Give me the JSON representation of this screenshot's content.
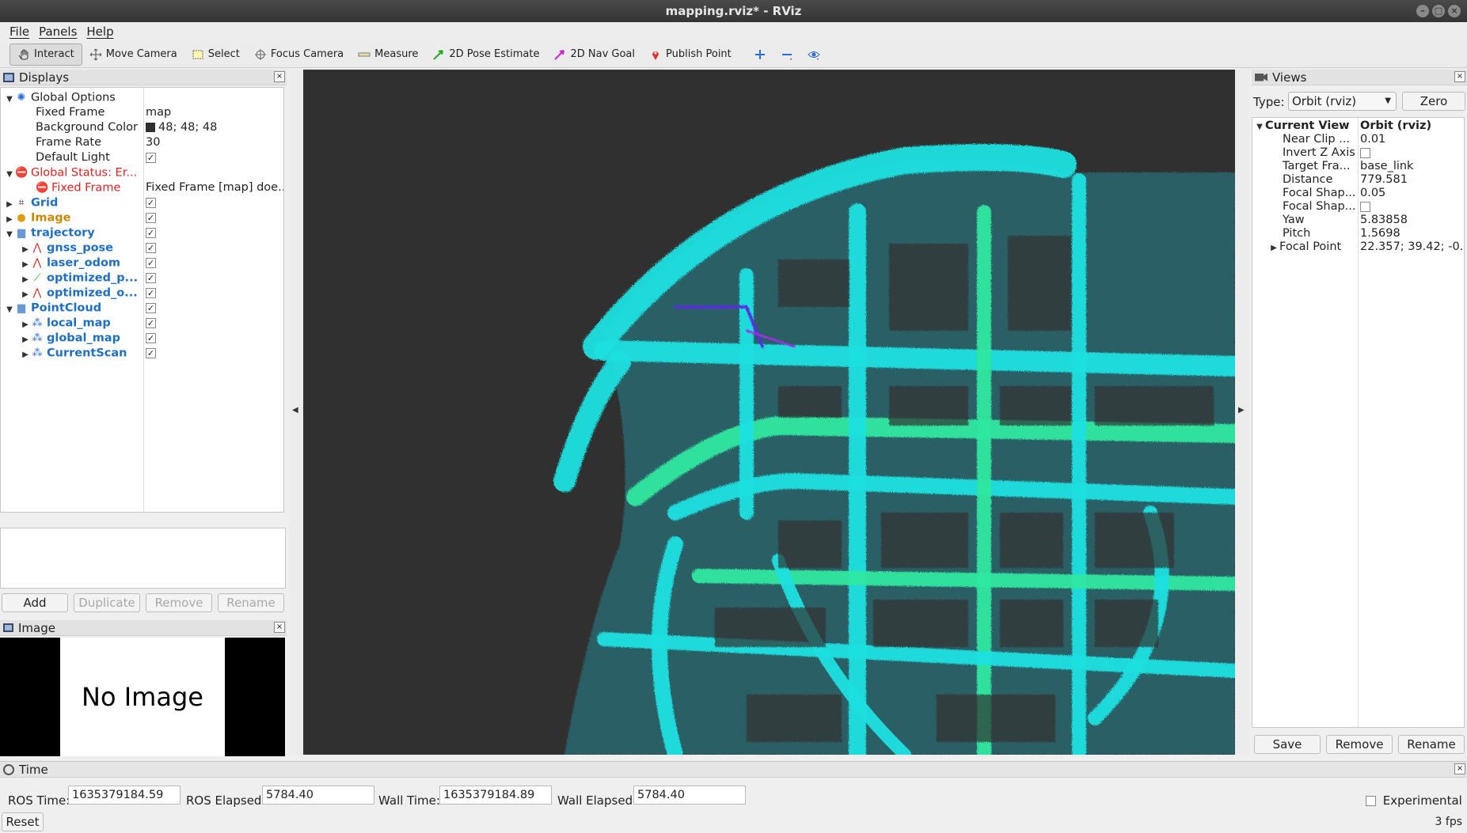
{
  "window": {
    "title": "mapping.rviz* - RViz"
  },
  "menubar": {
    "file": "File",
    "panels": "Panels",
    "help": "Help"
  },
  "toolbar": {
    "interact": "Interact",
    "move_camera": "Move Camera",
    "select": "Select",
    "focus_camera": "Focus Camera",
    "measure": "Measure",
    "pose_estimate": "2D Pose Estimate",
    "nav_goal": "2D Nav Goal",
    "publish_point": "Publish Point"
  },
  "displays": {
    "title": "Displays",
    "rows": {
      "global_options": "Global Options",
      "fixed_frame_label": "Fixed Frame",
      "fixed_frame_value": "map",
      "bg_color_label": "Background Color",
      "bg_color_value": "48; 48; 48",
      "frame_rate_label": "Frame Rate",
      "frame_rate_value": "30",
      "default_light_label": "Default Light",
      "global_status": "Global Status: Er...",
      "fixed_frame_err": "Fixed Frame",
      "fixed_frame_err_value": "Fixed Frame [map] doe...",
      "grid": "Grid",
      "image": "Image",
      "trajectory": "trajectory",
      "gnss_pose": "gnss_pose",
      "laser_odom": "laser_odom",
      "optimized_p": "optimized_p...",
      "optimized_o": "optimized_o...",
      "pointcloud": "PointCloud",
      "local_map": "local_map",
      "global_map": "global_map",
      "current_scan": "CurrentScan"
    },
    "buttons": {
      "add": "Add",
      "duplicate": "Duplicate",
      "remove": "Remove",
      "rename": "Rename"
    }
  },
  "image_panel": {
    "title": "Image",
    "no_image": "No Image"
  },
  "views": {
    "title": "Views",
    "type_label": "Type:",
    "type_value": "Orbit (rviz)",
    "zero": "Zero",
    "current_view": "Current View",
    "current_view_value": "Orbit (rviz)",
    "props": [
      {
        "label": "Near Clip ...",
        "value": "0.01"
      },
      {
        "label": "Invert Z Axis",
        "value": ""
      },
      {
        "label": "Target Fra...",
        "value": "base_link"
      },
      {
        "label": "Distance",
        "value": "779.581"
      },
      {
        "label": "Focal Shap...",
        "value": "0.05"
      },
      {
        "label": "Focal Shap...",
        "value": ""
      },
      {
        "label": "Yaw",
        "value": "5.83858"
      },
      {
        "label": "Pitch",
        "value": "1.5698"
      },
      {
        "label": "Focal Point",
        "value": "22.357; 39.42; -0..."
      }
    ],
    "buttons": {
      "save": "Save",
      "remove": "Remove",
      "rename": "Rename"
    }
  },
  "time": {
    "title": "Time",
    "ros_time_label": "ROS Time:",
    "ros_time": "1635379184.59",
    "ros_elapsed_label": "ROS Elapsed:",
    "ros_elapsed": "5784.40",
    "wall_time_label": "Wall Time:",
    "wall_time": "1635379184.89",
    "wall_elapsed_label": "Wall Elapsed:",
    "wall_elapsed": "5784.40",
    "experimental": "Experimental",
    "reset": "Reset",
    "fps": "3 fps"
  },
  "colors": {
    "background": "#303030",
    "map_cyan": "#1de0e0",
    "map_green": "#2fe8a0",
    "error_red": "#dd2222",
    "link_blue": "#1f6fc2"
  }
}
